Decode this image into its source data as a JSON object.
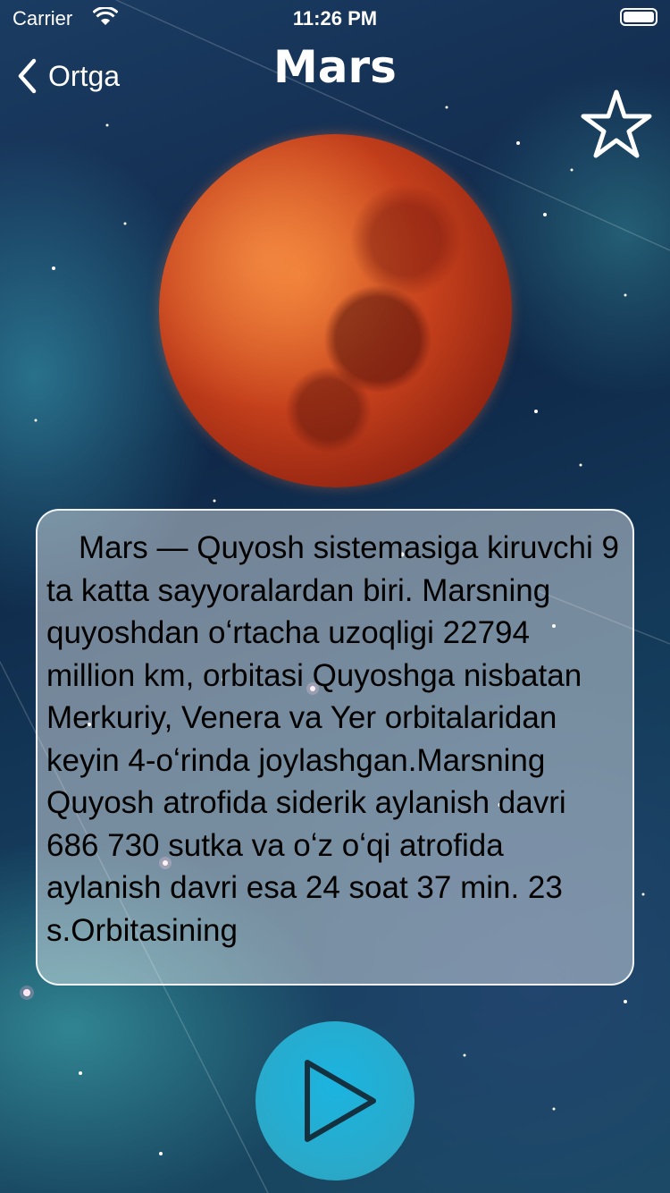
{
  "status_bar": {
    "carrier": "Carrier",
    "time": "11:26 PM"
  },
  "nav": {
    "back_label": "Ortga",
    "title": "Mars"
  },
  "planet": {
    "name": "Mars"
  },
  "description": {
    "text": "Mars — Quyosh sistemasiga kiruvchi 9 ta katta sayyoralardan biri. Marsning quyoshdan oʻrtacha uzoqligi 22794 million km, orbitasi Quyoshga nisbatan Merkuriy, Venera va Yer orbitalaridan keyin 4-oʻrinda joylashgan.Marsning Quyosh atrofida siderik aylanish davri 686 730 sutka va oʻz oʻqi atrofida aylanish davri esa 24 soat 37 min. 23 s.Orbitasining"
  },
  "icons": {
    "back": "chevron-left-icon",
    "favorite": "star-outline-icon",
    "play": "play-icon",
    "wifi": "wifi-icon",
    "battery": "battery-icon"
  },
  "colors": {
    "play_button": "#1bb4e0",
    "text_panel": "rgba(255,255,255,0.42)",
    "planet": "#c5401c"
  }
}
